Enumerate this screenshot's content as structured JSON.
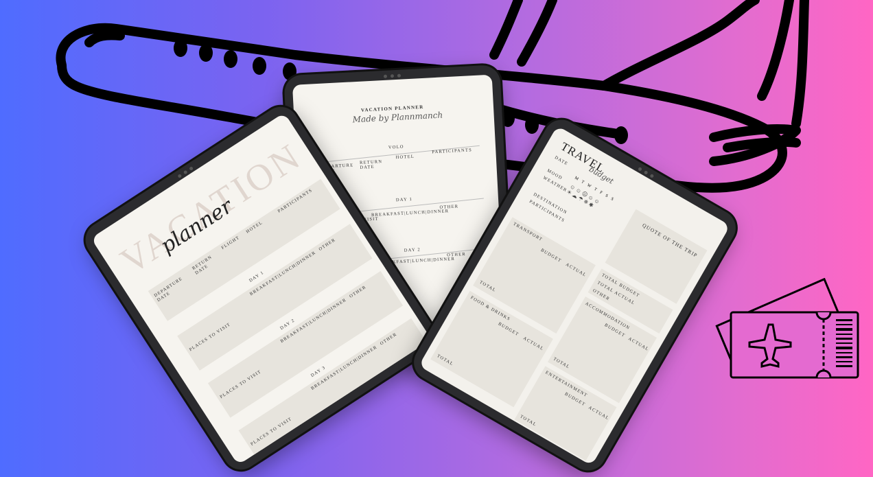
{
  "colors": {
    "bg_start": "#4f6cff",
    "bg_end": "#ff66c4",
    "outline": "#000000",
    "paper": "#f6f4ef",
    "panel": "#e7e4dd"
  },
  "icons": [
    "airplane-outline-icon",
    "plane-ticket-icon"
  ],
  "left_planner": {
    "title": "VACATION",
    "subtitle": "planner",
    "headers": [
      "DEPARTURE DATE",
      "RETURN DATE",
      "FLIGHT",
      "HOTEL",
      "PARTICIPANTS"
    ],
    "day1": "DAY 1",
    "day2": "DAY 2",
    "day3": "DAY 3",
    "meals": "BREAKFAST|LUNCH|DINNER",
    "other": "OTHER",
    "places": "PLACES TO VISIT"
  },
  "center_planner": {
    "title": "VACATION PLANNER",
    "subtitle": "Made by Plannmanch",
    "volo": "VOLO",
    "departure": "DEPARTURE DATE",
    "return": "RETURN DATE",
    "hotel": "HOTEL",
    "participants": "PARTICIPANTS",
    "day1": "DAY 1",
    "day2": "DAY 2",
    "meals": "BREAKFAST|LUNCH|DINNER",
    "other": "OTHER",
    "places": "PLACES TO VISIT"
  },
  "right_budget": {
    "title": "TRAVEL",
    "subtitle": "budget",
    "date": "DATE",
    "mood": "MOOD",
    "weather": "WEATHER",
    "days": [
      "M",
      "T",
      "W",
      "T",
      "F",
      "S",
      "S"
    ],
    "destination": "DESTINATION",
    "participants": "PARTICIPANTS",
    "quote": "QUOTE OF THE TRIP",
    "transport": "TRANSPORT",
    "budget": "BUDGET",
    "actual": "ACTUAL",
    "total": "TOTAL",
    "accommodation": "ACCOMMODATION",
    "food": "FOOD & DRINKS",
    "entertainment": "ENTERTAINMENT",
    "total_budget": "TOTAL BUDGET",
    "total_actual": "TOTAL ACTUAL",
    "other": "OTHER"
  }
}
